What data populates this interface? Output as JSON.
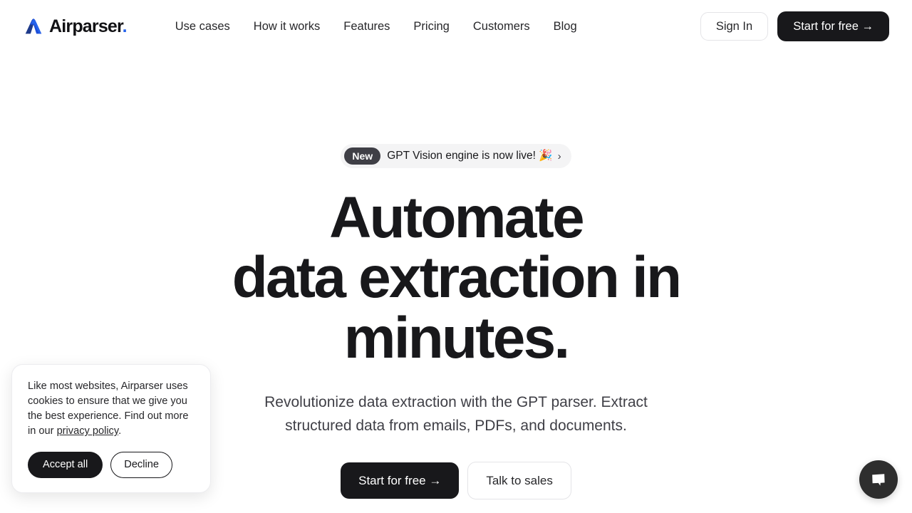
{
  "header": {
    "brand": {
      "logo_icon": "airparser-chevron-logo",
      "name": "Airparser",
      "dot": ".",
      "logo_color_dark": "#1e3a8a",
      "logo_color_light": "#2563eb",
      "dot_color": "#2563eb"
    },
    "nav": [
      {
        "label": "Use cases"
      },
      {
        "label": "How it works"
      },
      {
        "label": "Features"
      },
      {
        "label": "Pricing"
      },
      {
        "label": "Customers"
      },
      {
        "label": "Blog"
      }
    ],
    "signin_label": "Sign In",
    "cta_label": "Start for free →"
  },
  "hero": {
    "announcement": {
      "badge": "New",
      "text": "GPT Vision engine is now live! 🎉",
      "chevron_icon": "chevron-right-icon",
      "chevron": "›",
      "badge_bg": "#3f3f46",
      "pill_bg": "#f4f4f5"
    },
    "headline_line1": "Automate",
    "headline_line2": "data extraction in",
    "headline_line3": "minutes.",
    "subheading": "Revolutionize data extraction with the GPT parser. Extract structured data from emails, PDFs, and documents.",
    "primary_cta": "Start for free →",
    "secondary_cta": "Talk to sales"
  },
  "cookie_banner": {
    "text_before_link": "Like most websites, Airparser uses cookies to ensure that we give you the best experience. Find out more in our ",
    "link_label": "privacy policy",
    "text_after_link": ".",
    "accept_label": "Accept all",
    "decline_label": "Decline"
  },
  "chat_widget": {
    "icon": "chat-bubble-icon",
    "background": "#2e2e2e"
  },
  "theme": {
    "page_background": "#ffffff",
    "text_primary": "#18181b",
    "text_secondary": "#3f3f46",
    "dark_button": "#18181b",
    "border": "#e4e4e7"
  }
}
